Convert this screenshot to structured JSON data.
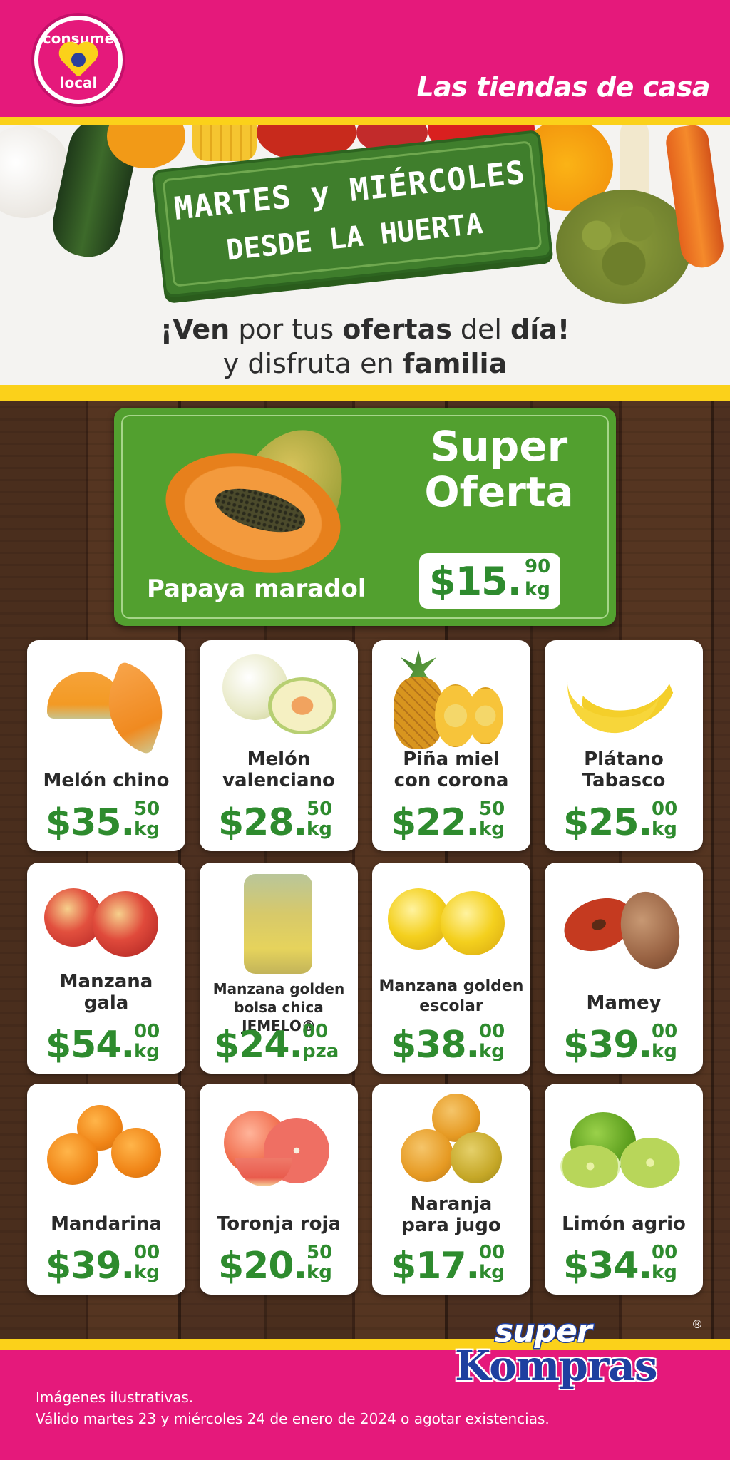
{
  "header": {
    "badge_top": "consume",
    "badge_bottom": "local",
    "tagline": "Las tiendas de casa"
  },
  "hero": {
    "sign_line1": "MARTES y MIÉRCOLES",
    "sign_line2": "DESDE LA HUERTA",
    "promo_line1_parts": [
      "¡Ven",
      " por tus ",
      "ofertas",
      " del ",
      "día",
      "!"
    ],
    "promo_line2_parts": [
      "y disfruta en ",
      "familia"
    ]
  },
  "super_offer": {
    "title_line1": "Super",
    "title_line2": "Oferta",
    "product": "Papaya maradol",
    "price_int": "$15.",
    "price_dec": "90",
    "unit": "kg"
  },
  "products": [
    {
      "name_lines": [
        "Melón chino"
      ],
      "price_int": "$35.",
      "price_dec": "50",
      "unit": "kg"
    },
    {
      "name_lines": [
        "Melón",
        "valenciano"
      ],
      "price_int": "$28.",
      "price_dec": "50",
      "unit": "kg"
    },
    {
      "name_lines": [
        "Piña miel",
        "con corona"
      ],
      "price_int": "$22.",
      "price_dec": "50",
      "unit": "kg"
    },
    {
      "name_lines": [
        "Plátano",
        "Tabasco"
      ],
      "price_int": "$25.",
      "price_dec": "00",
      "unit": "kg"
    },
    {
      "name_lines": [
        "Manzana",
        "gala"
      ],
      "price_int": "$54.",
      "price_dec": "00",
      "unit": "kg"
    },
    {
      "name_lines": [
        "Manzana golden",
        "bolsa chica JEMELO®"
      ],
      "price_int": "$24.",
      "price_dec": "00",
      "unit": "pza"
    },
    {
      "name_lines": [
        "Manzana golden",
        "escolar"
      ],
      "price_int": "$38.",
      "price_dec": "00",
      "unit": "kg"
    },
    {
      "name_lines": [
        "Mamey"
      ],
      "price_int": "$39.",
      "price_dec": "00",
      "unit": "kg"
    },
    {
      "name_lines": [
        "Mandarina"
      ],
      "price_int": "$39.",
      "price_dec": "00",
      "unit": "kg"
    },
    {
      "name_lines": [
        "Toronja roja"
      ],
      "price_int": "$20.",
      "price_dec": "50",
      "unit": "kg"
    },
    {
      "name_lines": [
        "Naranja",
        "para jugo"
      ],
      "price_int": "$17.",
      "price_dec": "00",
      "unit": "kg"
    },
    {
      "name_lines": [
        "Limón agrio"
      ],
      "price_int": "$34.",
      "price_dec": "00",
      "unit": "kg"
    }
  ],
  "footer": {
    "note1": "Imágenes ilustrativas.",
    "note2": "Válido martes 23 y miércoles 24 de enero de 2024 o agotar existencias.",
    "brand_top": "super",
    "brand_bottom": "Kompras",
    "brand_reg": "®"
  },
  "colors": {
    "brand_pink": "#e5197b",
    "accent_yellow": "#fbd11a",
    "offer_green": "#52a02f",
    "price_green": "#2e8b2e",
    "brand_blue": "#1e3fa0"
  }
}
